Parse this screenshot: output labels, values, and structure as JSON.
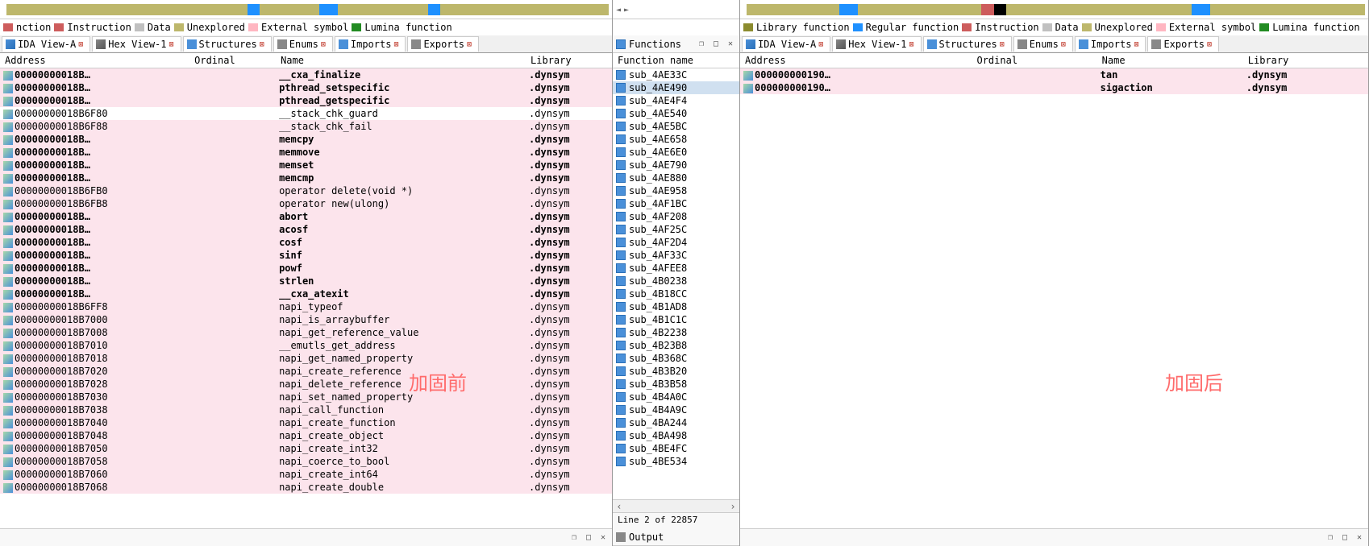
{
  "legend": {
    "items": [
      {
        "color": "#8b8b2e",
        "label": "Library function"
      },
      {
        "color": "#1e90ff",
        "label": "Regular function"
      },
      {
        "color": "#cd5c5c",
        "label": "Instruction"
      },
      {
        "color": "#c0c0c0",
        "label": "Data"
      },
      {
        "color": "#bdb76b",
        "label": "Unexplored"
      },
      {
        "color": "#ffb6c1",
        "label": "External symbol"
      },
      {
        "color": "#228b22",
        "label": "Lumina function"
      }
    ],
    "left_items": [
      {
        "color": "#cd5c5c",
        "label": "nction"
      },
      {
        "color": "#cd5c5c",
        "label": "Instruction"
      },
      {
        "color": "#c0c0c0",
        "label": "Data"
      },
      {
        "color": "#bdb76b",
        "label": "Unexplored"
      },
      {
        "color": "#ffb6c1",
        "label": "External symbol"
      },
      {
        "color": "#228b22",
        "label": "Lumina function"
      }
    ]
  },
  "tabs": [
    {
      "icon": "icon-ida",
      "label": "IDA View-A"
    },
    {
      "icon": "icon-hex",
      "label": "Hex View-1"
    },
    {
      "icon": "icon-struct",
      "label": "Structures"
    },
    {
      "icon": "icon-enum",
      "label": "Enums"
    },
    {
      "icon": "icon-imp",
      "label": "Imports",
      "active": true
    },
    {
      "icon": "icon-exp",
      "label": "Exports"
    }
  ],
  "imports_left": {
    "headers": [
      "Address",
      "Ordinal",
      "Name",
      "Library"
    ],
    "rows": [
      {
        "a": "00000000018B…",
        "n": "__cxa_finalize",
        "l": ".dynsym",
        "b": true,
        "h": true
      },
      {
        "a": "00000000018B…",
        "n": "pthread_setspecific",
        "l": ".dynsym",
        "b": true,
        "h": true
      },
      {
        "a": "00000000018B…",
        "n": "pthread_getspecific",
        "l": ".dynsym",
        "b": true,
        "h": true
      },
      {
        "a": "00000000018B6F80",
        "n": "__stack_chk_guard",
        "l": ".dynsym",
        "b": false,
        "h": false
      },
      {
        "a": "00000000018B6F88",
        "n": "__stack_chk_fail",
        "l": ".dynsym",
        "b": false,
        "h": true
      },
      {
        "a": "00000000018B…",
        "n": "memcpy",
        "l": ".dynsym",
        "b": true,
        "h": true
      },
      {
        "a": "00000000018B…",
        "n": "memmove",
        "l": ".dynsym",
        "b": true,
        "h": true
      },
      {
        "a": "00000000018B…",
        "n": "memset",
        "l": ".dynsym",
        "b": true,
        "h": true
      },
      {
        "a": "00000000018B…",
        "n": "memcmp",
        "l": ".dynsym",
        "b": true,
        "h": true
      },
      {
        "a": "00000000018B6FB0",
        "n": "operator delete(void *)",
        "l": ".dynsym",
        "b": false,
        "h": true
      },
      {
        "a": "00000000018B6FB8",
        "n": "operator new(ulong)",
        "l": ".dynsym",
        "b": false,
        "h": true
      },
      {
        "a": "00000000018B…",
        "n": "abort",
        "l": ".dynsym",
        "b": true,
        "h": true
      },
      {
        "a": "00000000018B…",
        "n": "acosf",
        "l": ".dynsym",
        "b": true,
        "h": true
      },
      {
        "a": "00000000018B…",
        "n": "cosf",
        "l": ".dynsym",
        "b": true,
        "h": true
      },
      {
        "a": "00000000018B…",
        "n": "sinf",
        "l": ".dynsym",
        "b": true,
        "h": true
      },
      {
        "a": "00000000018B…",
        "n": "powf",
        "l": ".dynsym",
        "b": true,
        "h": true
      },
      {
        "a": "00000000018B…",
        "n": "strlen",
        "l": ".dynsym",
        "b": true,
        "h": true
      },
      {
        "a": "00000000018B…",
        "n": "__cxa_atexit",
        "l": ".dynsym",
        "b": true,
        "h": true
      },
      {
        "a": "00000000018B6FF8",
        "n": "napi_typeof",
        "l": ".dynsym",
        "b": false,
        "h": true
      },
      {
        "a": "00000000018B7000",
        "n": "napi_is_arraybuffer",
        "l": ".dynsym",
        "b": false,
        "h": true
      },
      {
        "a": "00000000018B7008",
        "n": "napi_get_reference_value",
        "l": ".dynsym",
        "b": false,
        "h": true
      },
      {
        "a": "00000000018B7010",
        "n": "__emutls_get_address",
        "l": ".dynsym",
        "b": false,
        "h": true
      },
      {
        "a": "00000000018B7018",
        "n": "napi_get_named_property",
        "l": ".dynsym",
        "b": false,
        "h": true
      },
      {
        "a": "00000000018B7020",
        "n": "napi_create_reference",
        "l": ".dynsym",
        "b": false,
        "h": true
      },
      {
        "a": "00000000018B7028",
        "n": "napi_delete_reference",
        "l": ".dynsym",
        "b": false,
        "h": true
      },
      {
        "a": "00000000018B7030",
        "n": "napi_set_named_property",
        "l": ".dynsym",
        "b": false,
        "h": true
      },
      {
        "a": "00000000018B7038",
        "n": "napi_call_function",
        "l": ".dynsym",
        "b": false,
        "h": true
      },
      {
        "a": "00000000018B7040",
        "n": "napi_create_function",
        "l": ".dynsym",
        "b": false,
        "h": true
      },
      {
        "a": "00000000018B7048",
        "n": "napi_create_object",
        "l": ".dynsym",
        "b": false,
        "h": true
      },
      {
        "a": "00000000018B7050",
        "n": "napi_create_int32",
        "l": ".dynsym",
        "b": false,
        "h": true
      },
      {
        "a": "00000000018B7058",
        "n": "napi_coerce_to_bool",
        "l": ".dynsym",
        "b": false,
        "h": true
      },
      {
        "a": "00000000018B7060",
        "n": "napi_create_int64",
        "l": ".dynsym",
        "b": false,
        "h": true
      },
      {
        "a": "00000000018B7068",
        "n": "napi_create_double",
        "l": ".dynsym",
        "b": false,
        "h": true
      }
    ]
  },
  "functions": {
    "title": "Functions",
    "header": "Function name",
    "items": [
      "sub_4AE33C",
      "sub_4AE490",
      "sub_4AE4F4",
      "sub_4AE540",
      "sub_4AE5BC",
      "sub_4AE658",
      "sub_4AE6E0",
      "sub_4AE790",
      "sub_4AE880",
      "sub_4AE958",
      "sub_4AF1BC",
      "sub_4AF208",
      "sub_4AF25C",
      "sub_4AF2D4",
      "sub_4AF33C",
      "sub_4AFEE8",
      "sub_4B0238",
      "sub_4B18CC",
      "sub_4B1AD8",
      "sub_4B1C1C",
      "sub_4B2238",
      "sub_4B23B8",
      "sub_4B368C",
      "sub_4B3B20",
      "sub_4B3B58",
      "sub_4B4A0C",
      "sub_4B4A9C",
      "sub_4BA244",
      "sub_4BA498",
      "sub_4BE4FC",
      "sub_4BE534"
    ],
    "selected": 1,
    "status": "Line 2 of 22857"
  },
  "imports_right": {
    "headers": [
      "Address",
      "Ordinal",
      "Name",
      "Library"
    ],
    "rows": [
      {
        "a": "000000000190…",
        "n": "tan",
        "l": ".dynsym",
        "b": true,
        "h": true
      },
      {
        "a": "000000000190…",
        "n": "sigaction",
        "l": ".dynsym",
        "b": true,
        "h": true
      }
    ]
  },
  "overlay": {
    "left": "加固前",
    "right": "加固后"
  },
  "output": {
    "label": "Output"
  }
}
